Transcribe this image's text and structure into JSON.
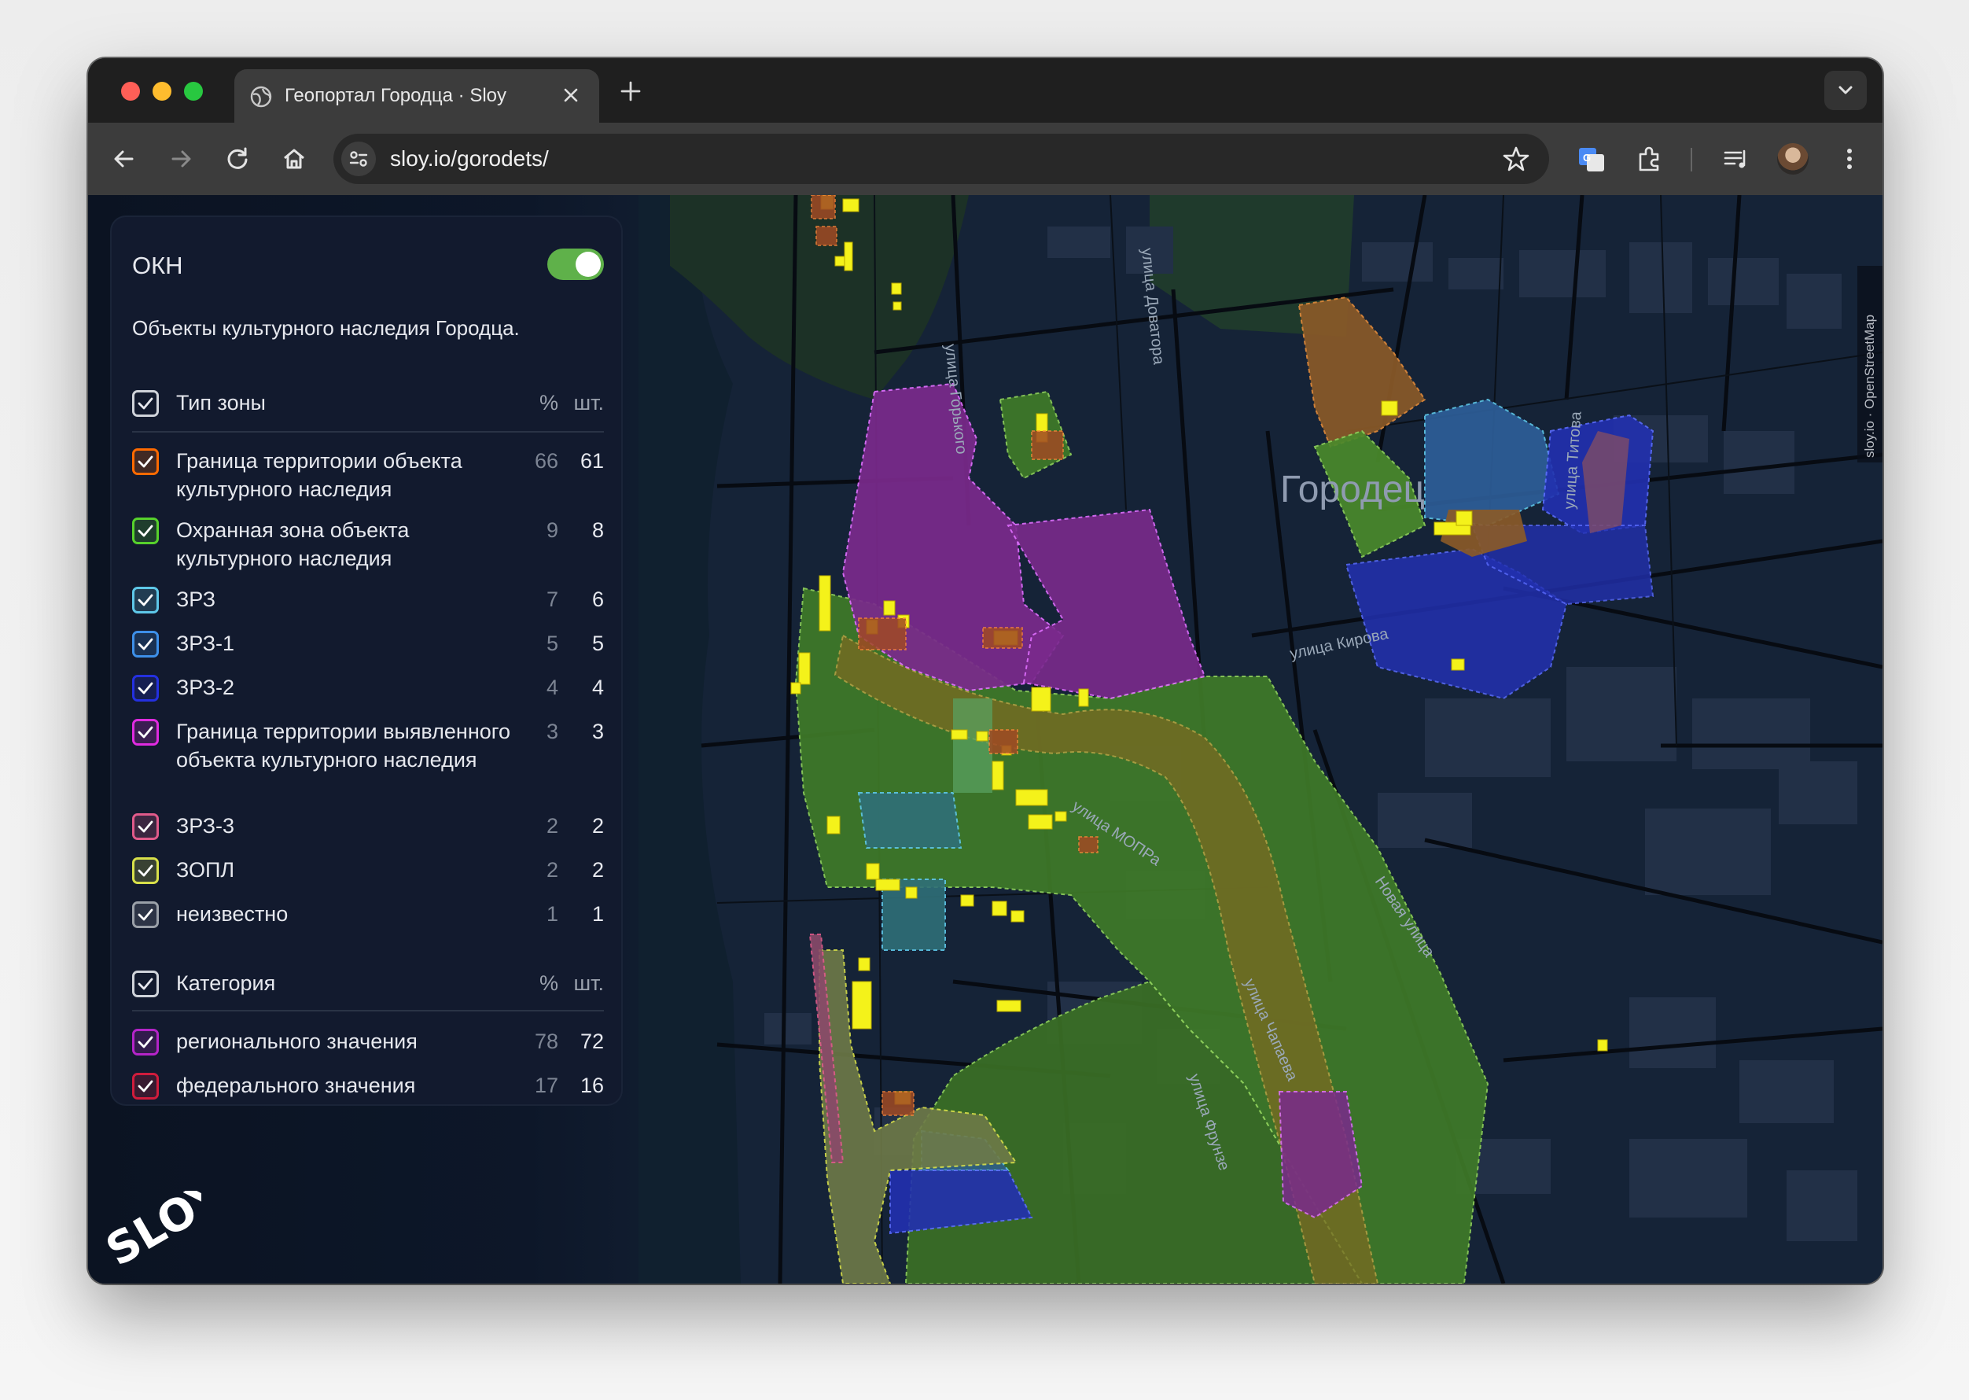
{
  "browser": {
    "tab_title": "Геопортал Городца · Sloy",
    "url": "sloy.io/gorodets/"
  },
  "map": {
    "city_label": "Городец",
    "street_labels": [
      "улица Горького",
      "улица Доватора",
      "улица Титова",
      "улица Кирова",
      "улица МОПРа",
      "Новая улица",
      "улица Чапаева",
      "улица Фрунзе"
    ],
    "attribution": "sloy.io · OpenStreetMap"
  },
  "panel": {
    "title": "ОКН",
    "toggle_on": true,
    "description": "Объекты культурного наследия Городца.",
    "zone_type": {
      "header": "Тип зоны",
      "pct_header": "%",
      "count_header": "шт.",
      "items": [
        {
          "label": "Граница территории объекта культурного наследия",
          "pct": "66",
          "count": "61",
          "color": "#ff6a00"
        },
        {
          "label": "Охранная зона объекта культурного наследия",
          "pct": "9",
          "count": "8",
          "color": "#57d12c"
        },
        {
          "label": "ЗРЗ",
          "pct": "7",
          "count": "6",
          "color": "#5ec7e8"
        },
        {
          "label": "ЗРЗ-1",
          "pct": "5",
          "count": "5",
          "color": "#3d8fe8"
        },
        {
          "label": "ЗРЗ-2",
          "pct": "4",
          "count": "4",
          "color": "#2430e0"
        },
        {
          "label": "Граница территории выявленного объекта культурного наследия",
          "pct": "3",
          "count": "3",
          "color": "#e02be0"
        },
        {
          "label": "ЗРЗ-3",
          "pct": "2",
          "count": "2",
          "color": "#e05a8a"
        },
        {
          "label": "ЗОПЛ",
          "pct": "2",
          "count": "2",
          "color": "#d8e04a"
        },
        {
          "label": "неизвестно",
          "pct": "1",
          "count": "1",
          "color": "#9aa0a8"
        }
      ]
    },
    "category": {
      "header": "Категория",
      "pct_header": "%",
      "count_header": "шт.",
      "items": [
        {
          "label": "регионального значения",
          "pct": "78",
          "count": "72",
          "color": "#b424c8"
        },
        {
          "label": "федерального значения",
          "pct": "17",
          "count": "16",
          "color": "#d01c3c"
        }
      ]
    }
  },
  "logo_text": "SLOY"
}
